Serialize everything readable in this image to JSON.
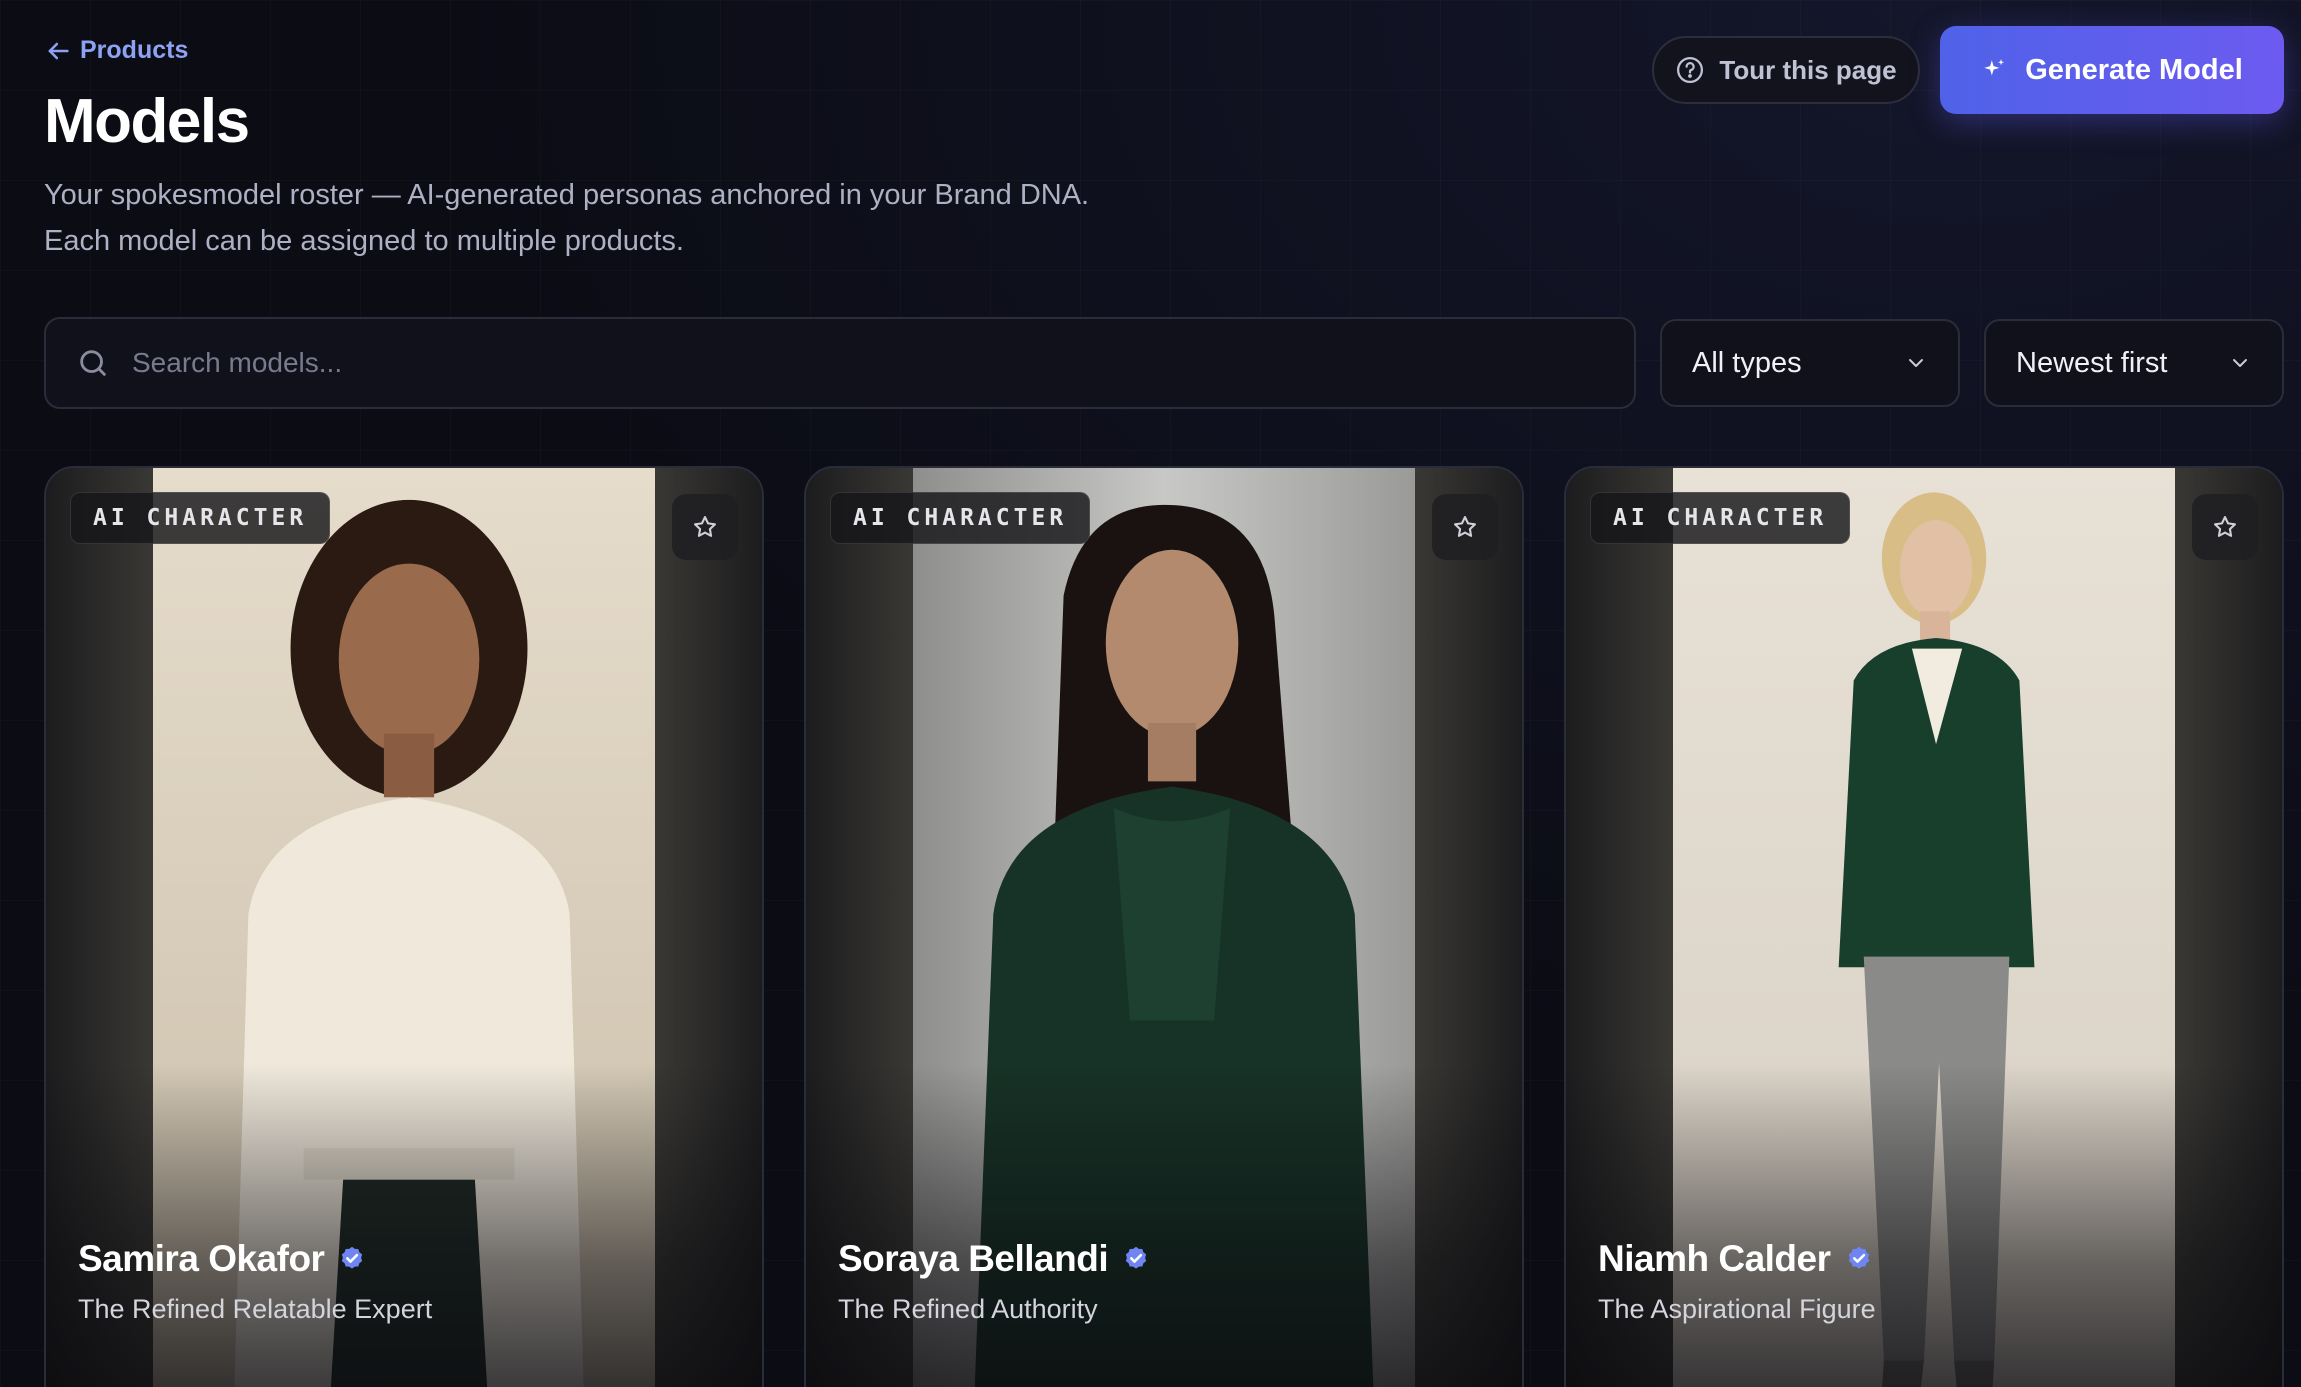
{
  "header": {
    "back_label": "Products",
    "title": "Models",
    "subtitle_line1": "Your spokesmodel roster — AI-generated personas anchored in your Brand DNA.",
    "subtitle_line2": "Each model can be assigned to multiple products."
  },
  "actions": {
    "tour_label": "Tour this page",
    "generate_label": "Generate Model"
  },
  "filters": {
    "search_placeholder": "Search models...",
    "search_value": "",
    "type_selected": "All types",
    "sort_selected": "Newest first"
  },
  "cards": [
    {
      "badge": "AI CHARACTER",
      "name": "Samira Okafor",
      "persona": "The Refined Relatable Expert",
      "verified": true,
      "favorited": false
    },
    {
      "badge": "AI CHARACTER",
      "name": "Soraya Bellandi",
      "persona": "The Refined Authority",
      "verified": true,
      "favorited": false
    },
    {
      "badge": "AI CHARACTER",
      "name": "Niamh Calder",
      "persona": "The Aspirational Figure",
      "verified": true,
      "favorited": false
    }
  ],
  "colors": {
    "background": "#0b0c14",
    "accent": "#5a60ec",
    "link": "#8ea2f3",
    "verified": "#6f86f2"
  },
  "icons": {
    "back": "arrow-left-icon",
    "tour": "help-circle-icon",
    "generate": "sparkle-icon",
    "search": "search-icon",
    "dropdown": "chevron-down-icon",
    "favorite": "star-icon",
    "verified": "verified-badge-icon"
  }
}
